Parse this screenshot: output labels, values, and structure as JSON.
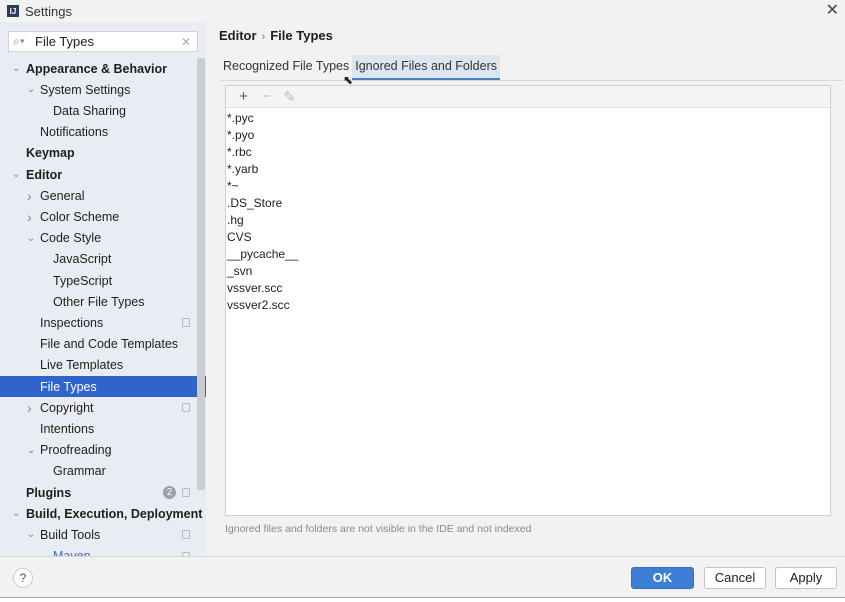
{
  "window": {
    "title": "Settings",
    "logo": "IJ"
  },
  "search": {
    "value": "File Types"
  },
  "tree": [
    {
      "label": "Appearance & Behavior",
      "level": 0,
      "bold": true,
      "chevron": "down"
    },
    {
      "label": "System Settings",
      "level": 1,
      "chevron": "down"
    },
    {
      "label": "Data Sharing",
      "level": 2
    },
    {
      "label": "Notifications",
      "level": 1
    },
    {
      "label": "Keymap",
      "level": 0,
      "bold": true
    },
    {
      "label": "Editor",
      "level": 0,
      "bold": true,
      "chevron": "down"
    },
    {
      "label": "General",
      "level": 1,
      "chevron": "right"
    },
    {
      "label": "Color Scheme",
      "level": 1,
      "chevron": "right"
    },
    {
      "label": "Code Style",
      "level": 1,
      "chevron": "down"
    },
    {
      "label": "JavaScript",
      "level": 2
    },
    {
      "label": "TypeScript",
      "level": 2
    },
    {
      "label": "Other File Types",
      "level": 2
    },
    {
      "label": "Inspections",
      "level": 1,
      "project": true
    },
    {
      "label": "File and Code Templates",
      "level": 1
    },
    {
      "label": "Live Templates",
      "level": 1
    },
    {
      "label": "File Types",
      "level": 1,
      "selected": true
    },
    {
      "label": "Copyright",
      "level": 1,
      "chevron": "right",
      "project": true
    },
    {
      "label": "Intentions",
      "level": 1
    },
    {
      "label": "Proofreading",
      "level": 1,
      "chevron": "down"
    },
    {
      "label": "Grammar",
      "level": 2
    },
    {
      "label": "Plugins",
      "level": 0,
      "bold": true,
      "badge": "2",
      "project": true
    },
    {
      "label": "Build, Execution, Deployment",
      "level": 0,
      "bold": true,
      "chevron": "down"
    },
    {
      "label": "Build Tools",
      "level": 1,
      "chevron": "down",
      "project": true
    },
    {
      "label": "Maven",
      "level": 2,
      "chevron": "down",
      "link": true,
      "project": true
    }
  ],
  "breadcrumb": {
    "parent": "Editor",
    "separator": "›",
    "current": "File Types"
  },
  "tabs": [
    {
      "label": "Recognized File Types"
    },
    {
      "label": "Ignored Files and Folders",
      "active": true
    }
  ],
  "toolbar": {
    "add": "+",
    "remove": "−",
    "edit": "✎"
  },
  "ignored": [
    "*.pyc",
    "*.pyo",
    "*.rbc",
    "*.yarb",
    "*~",
    ".DS_Store",
    ".hg",
    "CVS",
    "__pycache__",
    "_svn",
    "vssver.scc",
    "vssver2.scc"
  ],
  "hint": "Ignored files and folders are not visible in the IDE and not indexed",
  "buttons": {
    "help": "?",
    "ok": "OK",
    "cancel": "Cancel",
    "apply": "Apply"
  },
  "colors": {
    "accent": "#2f65ca",
    "ok": "#3d7fd4"
  }
}
